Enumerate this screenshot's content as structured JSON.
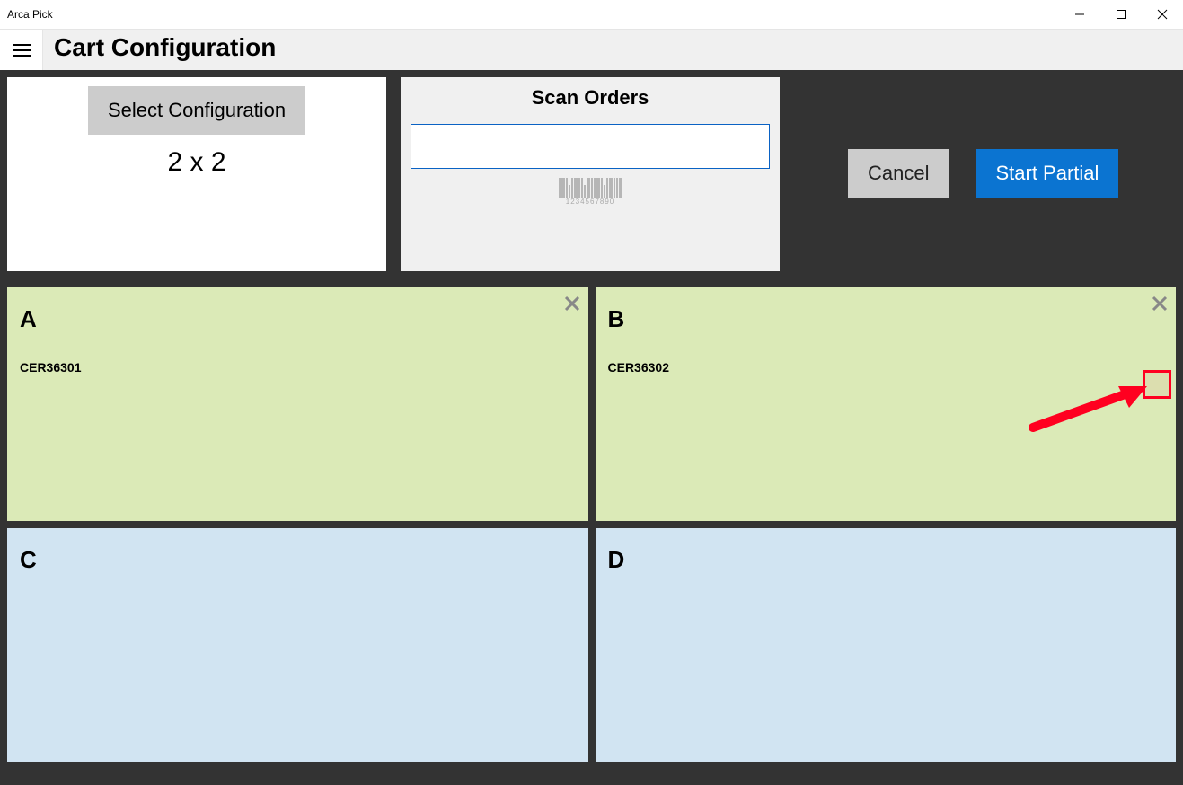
{
  "app_title": "Arca Pick",
  "page_title": "Cart Configuration",
  "config_panel": {
    "button_label": "Select Configuration",
    "value": "2 x 2"
  },
  "scan_panel": {
    "title": "Scan Orders",
    "input_value": "",
    "barcode_sample": "1234567890"
  },
  "actions": {
    "cancel": "Cancel",
    "start_partial": "Start Partial"
  },
  "slots": [
    {
      "letter": "A",
      "order": "CER36301",
      "filled": true,
      "closeable": true
    },
    {
      "letter": "B",
      "order": "CER36302",
      "filled": true,
      "closeable": true
    },
    {
      "letter": "C",
      "order": "",
      "filled": false,
      "closeable": false
    },
    {
      "letter": "D",
      "order": "",
      "filled": false,
      "closeable": false
    }
  ]
}
